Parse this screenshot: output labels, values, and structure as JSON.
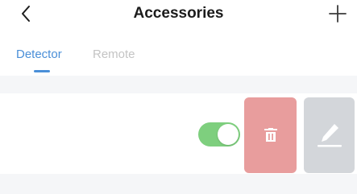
{
  "header": {
    "title": "Accessories",
    "back_icon": "chevron-left-icon",
    "add_icon": "plus-icon"
  },
  "tabs": [
    {
      "label": "Detector",
      "active": true
    },
    {
      "label": "Remote",
      "active": false
    }
  ],
  "accessory_row": {
    "toggle_on": true,
    "delete_icon": "trash-icon",
    "edit_icon": "pencil-icon"
  },
  "colors": {
    "accent": "#4a8fd8",
    "toggle_on": "#7ecf7e",
    "delete_bg": "#e89d9d",
    "edit_bg": "#d3d6da",
    "section_bg": "#f5f6f8"
  }
}
